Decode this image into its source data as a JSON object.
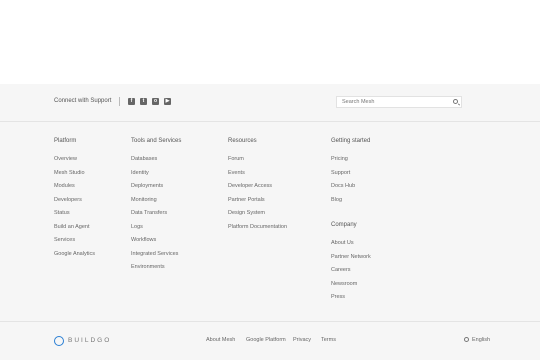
{
  "footer": {
    "connect_label": "Connect with Support",
    "social_icons": [
      "facebook-icon",
      "twitter-icon",
      "instagram-icon",
      "youtube-icon"
    ],
    "search_placeholder": "Search Mesh",
    "columns": [
      {
        "title": "Platform",
        "links": [
          "Overview",
          "Mesh Studio",
          "Modules",
          "Developers",
          "Status",
          "Build an Agent",
          "Services",
          "Google Analytics"
        ]
      },
      {
        "title": "Tools and Services",
        "links": [
          "Databases",
          "Identity",
          "Deployments",
          "Monitoring",
          "Data Transfers",
          "Logs",
          "Workflows",
          "Integrated Services",
          "Environments"
        ]
      },
      {
        "title": "Resources",
        "links": [
          "Forum",
          "Events",
          "Developer Access",
          "Partner Portals",
          "Design System",
          "Platform Documentation"
        ]
      },
      {
        "title": "Getting started",
        "links": [
          "Pricing",
          "Support",
          "Docs Hub",
          "Blog"
        ]
      },
      {
        "title": "Company",
        "links": [
          "About Us",
          "Partner Network",
          "Careers",
          "Newsroom",
          "Press"
        ]
      }
    ],
    "logo_text": "BUILDGO",
    "legal_links": [
      "About Mesh",
      "Google Platform",
      "Privacy",
      "Terms"
    ],
    "language": "English"
  },
  "colors": {
    "footer_bg": "#f6f6f6",
    "brand_accent": "#2a7fd4"
  }
}
